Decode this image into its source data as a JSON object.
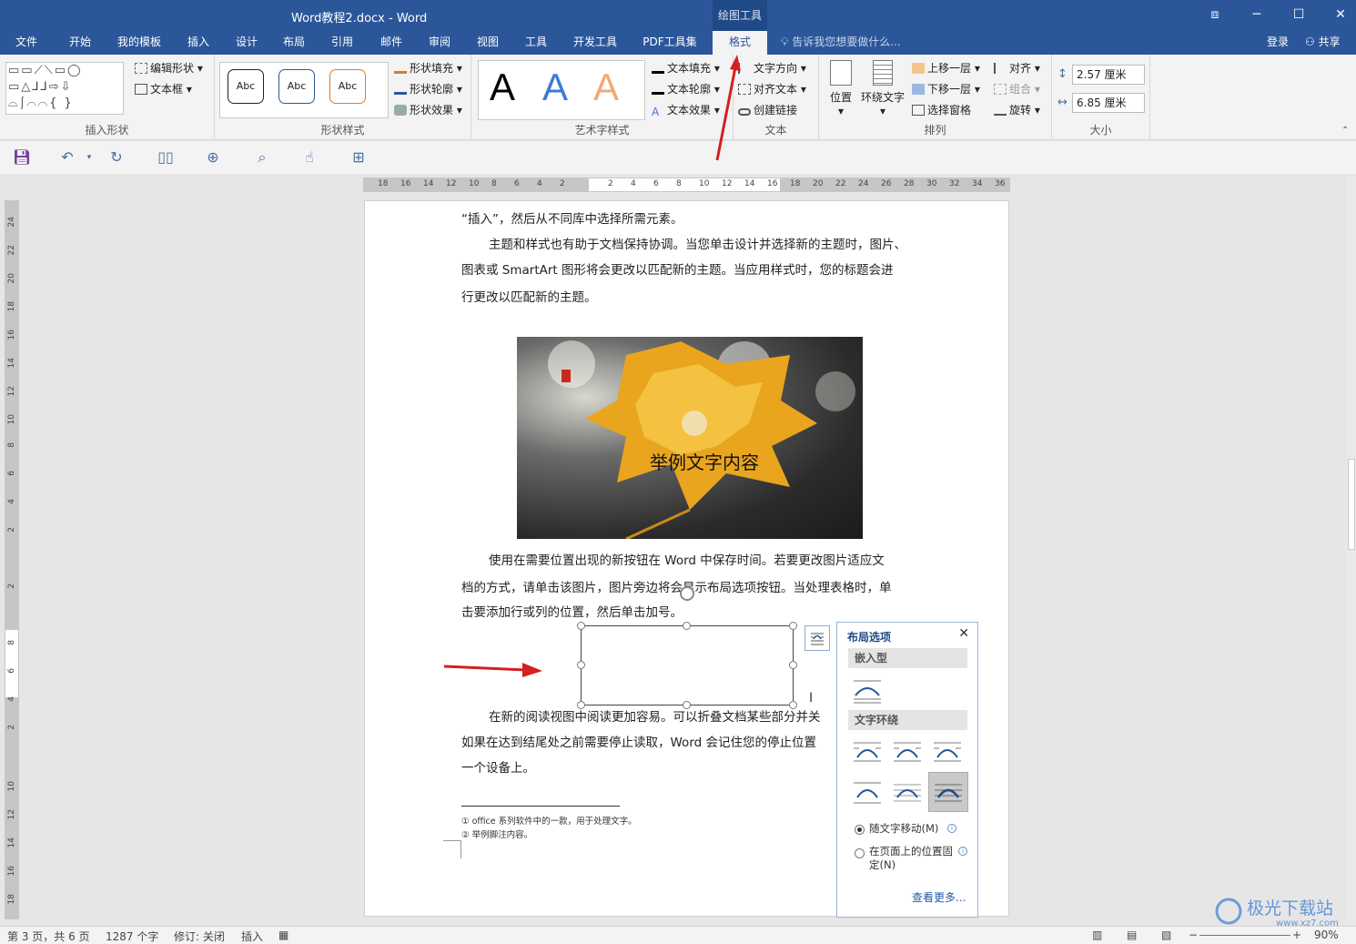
{
  "window": {
    "title": "Word教程2.docx - Word",
    "context_tab_group": "绘图工具",
    "controls": {
      "restore_ribbon": "⧈",
      "minimize": "─",
      "maximize": "☐",
      "close": "✕"
    }
  },
  "tabs": [
    {
      "label": "文件"
    },
    {
      "label": "开始"
    },
    {
      "label": "我的模板"
    },
    {
      "label": "插入"
    },
    {
      "label": "设计"
    },
    {
      "label": "布局"
    },
    {
      "label": "引用"
    },
    {
      "label": "邮件"
    },
    {
      "label": "审阅"
    },
    {
      "label": "视图"
    },
    {
      "label": "工具"
    },
    {
      "label": "开发工具"
    },
    {
      "label": "PDF工具集"
    },
    {
      "label": "格式"
    }
  ],
  "tell_me": "告诉我您想要做什么...",
  "account": {
    "login": "登录",
    "share": "共享"
  },
  "ribbon": {
    "insert_shapes": {
      "label": "插入形状",
      "edit_shape": "编辑形状",
      "text_box": "文本框"
    },
    "shape_styles": {
      "label": "形状样式",
      "sample": "Abc",
      "fill": "形状填充",
      "outline": "形状轮廓",
      "effects": "形状效果"
    },
    "wordart_styles": {
      "label": "艺术字样式",
      "sample": "A",
      "text_fill": "文本填充",
      "text_outline": "文本轮廓",
      "text_effects": "文本效果"
    },
    "text": {
      "label": "文本",
      "direction": "文字方向",
      "align": "对齐文本",
      "link": "创建链接"
    },
    "arrange": {
      "label": "排列",
      "position": "位置",
      "wrap": "环绕文字",
      "bring_forward": "上移一层",
      "send_backward": "下移一层",
      "selection_pane": "选择窗格",
      "align": "对齐",
      "group": "组合",
      "rotate": "旋转"
    },
    "size": {
      "label": "大小",
      "height": "2.57 厘米",
      "width": "6.85 厘米"
    }
  },
  "ruler": {
    "left_ticks": [
      "18",
      "16",
      "14",
      "12",
      "10",
      "8",
      "6",
      "4",
      "2"
    ],
    "right_ticks": [
      "2",
      "4",
      "6",
      "8",
      "10",
      "12",
      "14",
      "16",
      "18",
      "20",
      "22",
      "24",
      "26",
      "28",
      "30",
      "32",
      "34",
      "36"
    ],
    "vertical_ticks": [
      "24",
      "22",
      "20",
      "18",
      "16",
      "14",
      "12",
      "10",
      "8",
      "6",
      "4",
      "2",
      "",
      "2",
      "",
      "8",
      "6",
      "4",
      "2",
      "",
      "10",
      "12",
      "14",
      "16",
      "18"
    ]
  },
  "document": {
    "p1_line1": "“插入”，然后从不同库中选择所需元素。",
    "p2_line1": "主题和样式也有助于文档保持协调。当您单击设计并选择新的主题时，图片、",
    "p2_line2": "图表或 SmartArt 图形将会更改以匹配新的主题。当应用样式时，您的标题会进",
    "p2_line3": "行更改以匹配新的主题。",
    "image_caption": "举例文字内容",
    "p3_line1": "使用在需要位置出现的新按钮在 Word 中保存时间。若要更改图片适应文",
    "p3_line2": "档的方式，请单击该图片，图片旁边将会显示布局选项按钮。当处理表格时，单",
    "p3_line3": "击要添加行或列的位置，然后单击加号。",
    "p4_line1": "在新的阅读视图中阅读更加容易。可以折叠文档某些部分并关",
    "p4_line2": "如果在达到结尾处之前需要停止读取，Word 会记住您的停止位置",
    "p4_line3": "一个设备上。",
    "footnote1": "office 系列软件中的一款，用于处理文字。",
    "footnote2": "举例脚注内容。",
    "footnote_mark1": "①",
    "footnote_mark2": "②"
  },
  "layout_options": {
    "title": "布局选项",
    "inline_header": "嵌入型",
    "wrap_header": "文字环绕",
    "move_with_text": "随文字移动(M)",
    "fix_position": "在页面上的位置固定(N)",
    "see_more": "查看更多..."
  },
  "status": {
    "page": "第 3 页，共 6 页",
    "words": "1287 个字",
    "track": "修订: 关闭",
    "mode": "插入",
    "zoom": "90%"
  },
  "watermark": {
    "text": "极光下载站",
    "url": "www.xz7.com"
  },
  "colors": {
    "accent": "#2b579a",
    "arrow": "#d42020",
    "panel_border": "#9ab4d9"
  }
}
